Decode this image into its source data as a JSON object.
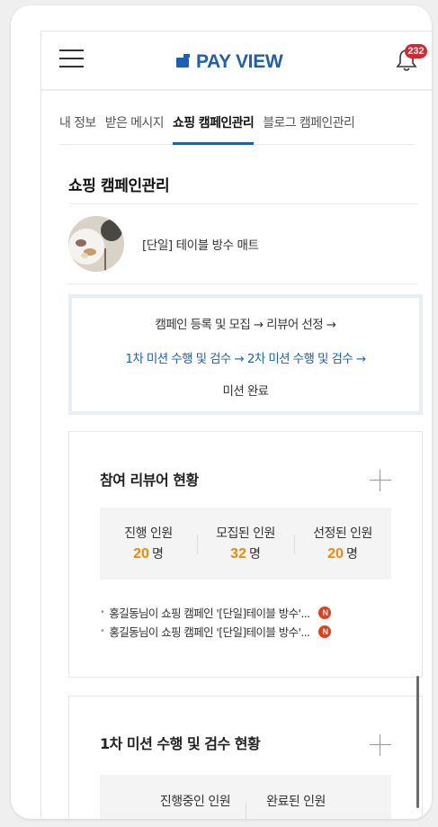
{
  "header": {
    "logo_text": "PAY VIEW",
    "notification_count": "232",
    "brand_color": "#1d5fb4",
    "badge_color": "#d8262f"
  },
  "tabs": [
    {
      "label": "내 정보",
      "active": false
    },
    {
      "label": "받은 메시지",
      "active": false
    },
    {
      "label": "쇼핑 캠페인관리",
      "active": true
    },
    {
      "label": "블로그 캠페인관리",
      "active": false
    }
  ],
  "page": {
    "title": "쇼핑 캠페인관리"
  },
  "product": {
    "name": "[단일] 테이블 방수 매트",
    "thumbnail_icon": "food-plate-thumbnail"
  },
  "process": {
    "row1": "캠페인 등록 및 모집  →  리뷰어 선정  →",
    "row2": "1차 미션 수행 및 검수  →  2차 미션 수행 및 검수  →",
    "row3": "미션 완료"
  },
  "reviewer_status": {
    "title": "참여 리뷰어 현황",
    "stats": [
      {
        "label": "진행 인원",
        "value": "20",
        "unit": "명"
      },
      {
        "label": "모집된 인원",
        "value": "32",
        "unit": "명"
      },
      {
        "label": "선정된 인원",
        "value": "20",
        "unit": "명"
      }
    ],
    "activities": [
      {
        "text": "홍길동님이 쇼핑 캠페인 '[단일]테이블 방수'...",
        "badge": "N"
      },
      {
        "text": "홍길동님이 쇼핑 캠페인 '[단일]테이블 방수'...",
        "badge": "N"
      }
    ]
  },
  "mission1_status": {
    "title": "1차 미션 수행 및 검수 현황",
    "stats": [
      {
        "label": "진행중인 인원"
      },
      {
        "label": "완료된 인원"
      }
    ]
  },
  "accent_color": "#f08a00"
}
